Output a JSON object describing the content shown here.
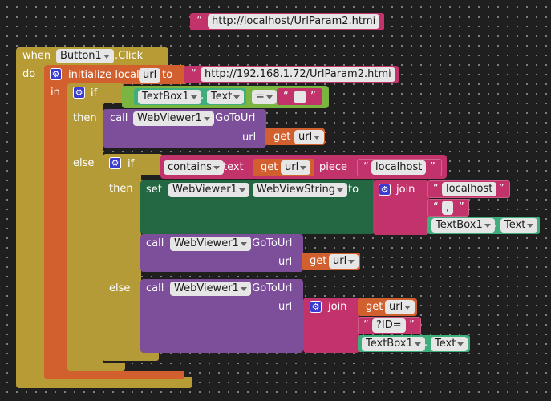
{
  "top_string": "http://localhost/UrlParam2.html",
  "event": {
    "when": "when",
    "component": "Button1",
    "event": ".Click",
    "do": "do"
  },
  "init_local": {
    "label": "initialize local",
    "var_name": "url",
    "to": "to",
    "value": "http://192.168.1.72/UrlParam2.html",
    "in": "in"
  },
  "if1": {
    "if": "if",
    "then": "then",
    "else": "else",
    "cond": {
      "component": "TextBox1",
      "prop": "Text",
      "op": "=",
      "empty": ""
    },
    "then_call": {
      "call": "call",
      "component": "WebViewer1",
      "method": ".GoToUrl",
      "arg": "url",
      "get": "get",
      "var": "url"
    }
  },
  "if2": {
    "if": "if",
    "then": "then",
    "else": "else",
    "cond": {
      "op": "contains",
      "text": "text",
      "get": "get",
      "var": "url",
      "piece": "piece",
      "piece_value": "localhost"
    },
    "set": {
      "set": "set",
      "component": "WebViewer1",
      "prop": "WebViewString",
      "to": "to",
      "join": "join",
      "items": [
        "localhost",
        ","
      ],
      "textbox": "TextBox1",
      "textbox_prop": "Text"
    },
    "then_call": {
      "call": "call",
      "component": "WebViewer1",
      "method": ".GoToUrl",
      "arg": "url",
      "get": "get",
      "var": "url"
    },
    "else_call": {
      "call": "call",
      "component": "WebViewer1",
      "method": ".GoToUrl",
      "arg": "url",
      "join": "join",
      "get": "get",
      "var": "url",
      "param": "?ID=",
      "textbox": "TextBox1",
      "textbox_prop": "Text"
    }
  },
  "colors": {
    "workspace": "#1f1f1f",
    "event": "#b79b35",
    "variable": "#d2602e",
    "control": "#b49b37",
    "text": "#c2326b",
    "component_call": "#7d4f9b",
    "setter": "#246743",
    "getter": "#3fae7c",
    "logic": "#7ab542"
  }
}
